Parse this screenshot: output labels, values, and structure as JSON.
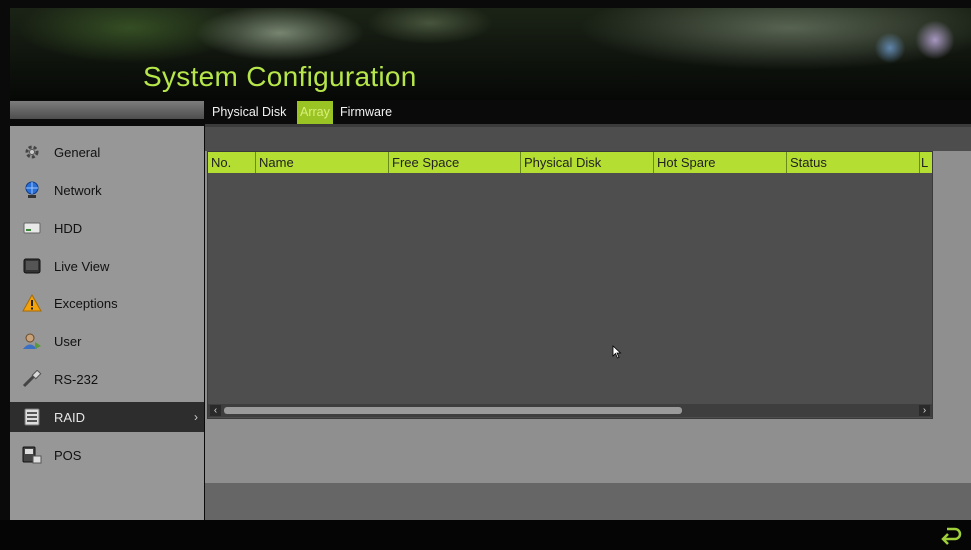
{
  "header": {
    "title": "System Configuration"
  },
  "tabs": [
    {
      "label": "Physical Disk",
      "active": false
    },
    {
      "label": "Array",
      "active": true
    },
    {
      "label": "Firmware",
      "active": false
    }
  ],
  "sidebar": {
    "items": [
      {
        "label": "General",
        "icon": "gear-icon"
      },
      {
        "label": "Network",
        "icon": "network-icon"
      },
      {
        "label": "HDD",
        "icon": "hdd-icon"
      },
      {
        "label": "Live View",
        "icon": "monitor-icon"
      },
      {
        "label": "Exceptions",
        "icon": "warning-icon"
      },
      {
        "label": "User",
        "icon": "user-icon"
      },
      {
        "label": "RS-232",
        "icon": "serial-icon"
      },
      {
        "label": "RAID",
        "icon": "raid-icon",
        "active": true,
        "chevron": "›"
      },
      {
        "label": "POS",
        "icon": "pos-icon"
      }
    ]
  },
  "table": {
    "columns": [
      "No.",
      "Name",
      "Free Space",
      "Physical Disk",
      "Hot Spare",
      "Status",
      "L"
    ],
    "rows": []
  },
  "scrollbar": {
    "left_arrow": "‹",
    "right_arrow": "›"
  },
  "colors": {
    "accent": "#b4de32",
    "title": "#b6e64a",
    "active_tab": "#9ac423"
  }
}
